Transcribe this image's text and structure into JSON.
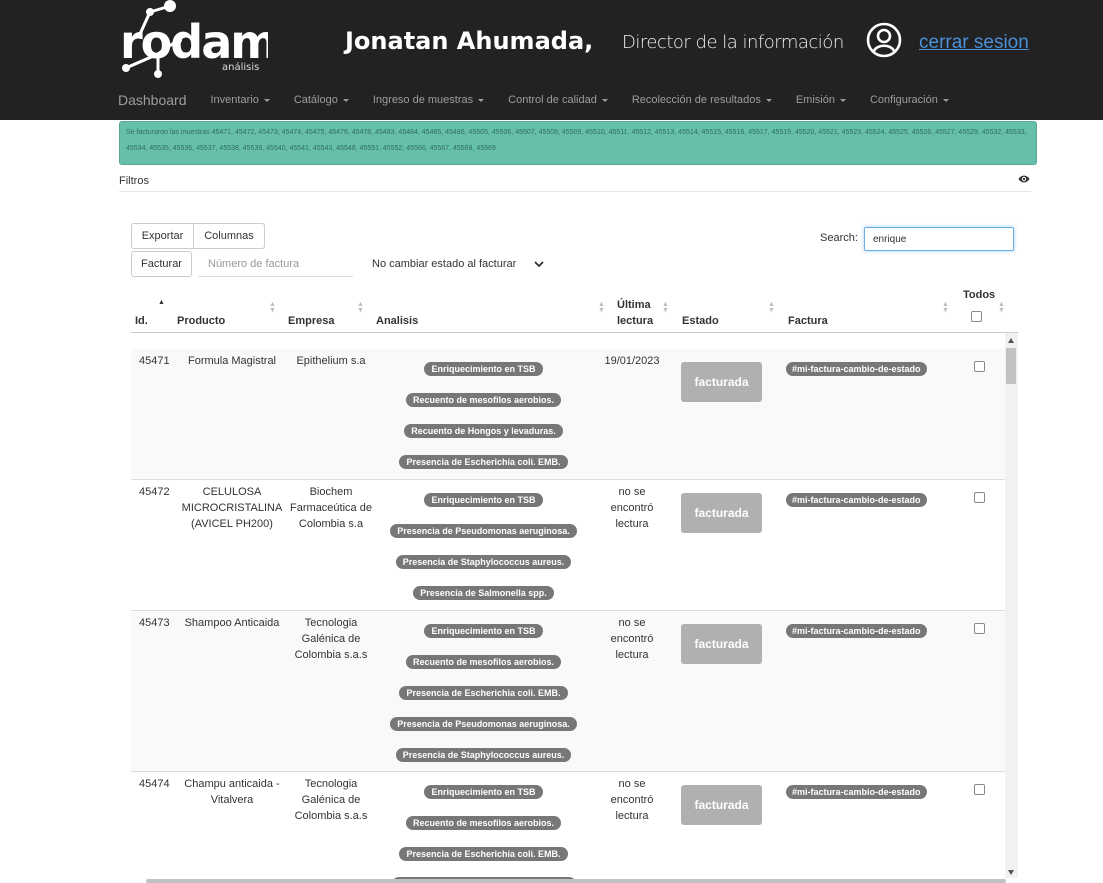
{
  "header": {
    "logo_text": "rodam",
    "logo_sub": "análisis",
    "user_name": "Jonatan Ahumada,",
    "user_role": "Director de la información",
    "logout": "cerrar sesion"
  },
  "nav": {
    "brand": "Dashboard",
    "items": [
      "Inventario",
      "Catálogo",
      "Ingreso de muestras",
      "Control de calidad",
      "Recolección de resultados",
      "Emisión",
      "Configuración"
    ]
  },
  "alert": {
    "text": "Se facturaron las muestras 45471, 45472, 45473, 45474, 45475, 45476, 45478, 45483, 45484, 45485, 45486, 45505, 45506, 45507, 45508, 45509, 45510, 45511, 45512, 45513, 45514, 45515, 45516, 45517, 45519, 45520, 45521, 45523, 45524, 45525, 45526, 45527, 45529, 45532, 45533, 45534, 45535, 45536, 45537, 45538, 45539, 45540, 45541, 45543, 45548, 45551, 45552, 45566, 45567, 45568, 45569"
  },
  "filters": {
    "label": "Filtros"
  },
  "toolbar": {
    "export_label": "Exportar",
    "columns_label": "Columnas",
    "invoice_label": "Facturar",
    "invoice_placeholder": "Número de factura",
    "state_select": "No cambiar estado al facturar",
    "search_label": "Search:",
    "search_value": "enrique"
  },
  "table": {
    "headers": {
      "id": "Id.",
      "product": "Producto",
      "company": "Empresa",
      "analysis": "Analisis",
      "last_read_1": "Última",
      "last_read_2": "lectura",
      "state": "Estado",
      "invoice": "Factura",
      "all": "Todos"
    },
    "rows": [
      {
        "id": "45471",
        "product": "Formula Magistral",
        "company": "Epithelium s.a",
        "analysis": [
          "Enriquecimiento en TSB",
          "Recuento de mesofilos aerobios.",
          "Recuento de Hongos y levaduras.",
          "Presencia de Escherichia coli. EMB."
        ],
        "last_read": "19/01/2023",
        "state": "facturada",
        "invoice": "#mi-factura-cambio-de-estado"
      },
      {
        "id": "45472",
        "product": "CELULOSA MICROCRISTALINA (AVICEL PH200)",
        "company": "Biochem Farmaceútica de Colombia s.a",
        "analysis": [
          "Enriquecimiento en TSB",
          "Presencia de Pseudomonas aeruginosa.",
          "Presencia de Staphylococcus aureus.",
          "Presencia de Salmonella spp."
        ],
        "last_read": "no se encontró lectura",
        "state": "facturada",
        "invoice": "#mi-factura-cambio-de-estado"
      },
      {
        "id": "45473",
        "product": "Shampoo Anticaida",
        "company": "Tecnologia Galénica de Colombia s.a.s",
        "analysis": [
          "Enriquecimiento en TSB",
          "Recuento de mesofilos aerobios.",
          "Presencia de Escherichia coli. EMB.",
          "Presencia de Pseudomonas aeruginosa.",
          "Presencia de Staphylococcus aureus."
        ],
        "last_read": "no se encontró lectura",
        "state": "facturada",
        "invoice": "#mi-factura-cambio-de-estado"
      },
      {
        "id": "45474",
        "product": "Champu anticaida - Vitalvera",
        "company": "Tecnologia Galénica de Colombia s.a.s",
        "analysis": [
          "Enriquecimiento en TSB",
          "Recuento de mesofilos aerobios.",
          "Presencia de Escherichia coli. EMB.",
          ""
        ],
        "last_read": "no se encontró lectura",
        "state": "facturada",
        "invoice": "#mi-factura-cambio-de-estado"
      }
    ]
  }
}
